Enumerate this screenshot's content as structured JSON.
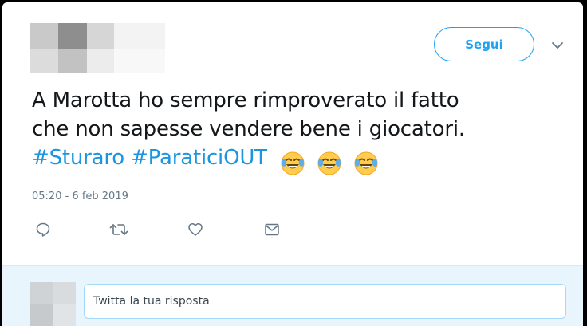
{
  "header": {
    "follow_label": "Segui"
  },
  "tweet": {
    "text_line1": "A Marotta ho sempre rimproverato il fatto",
    "text_line2": "che non sapesse vendere bene i giocatori.",
    "hashtags": [
      "#Sturaro",
      "#ParaticiOUT"
    ],
    "emoji": [
      "face-with-tears-of-joy-icon",
      "face-with-tears-of-joy-icon",
      "face-with-tears-of-joy-icon"
    ],
    "timestamp": "05:20 - 6 feb 2019"
  },
  "actions": [
    "reply-icon",
    "retweet-icon",
    "like-icon",
    "direct-message-icon"
  ],
  "reply": {
    "placeholder": "Twitta la tua risposta"
  },
  "colors": {
    "accent": "#1da1f2",
    "hashtag": "#1b95e0",
    "reply_background": "#e8f5fd"
  }
}
